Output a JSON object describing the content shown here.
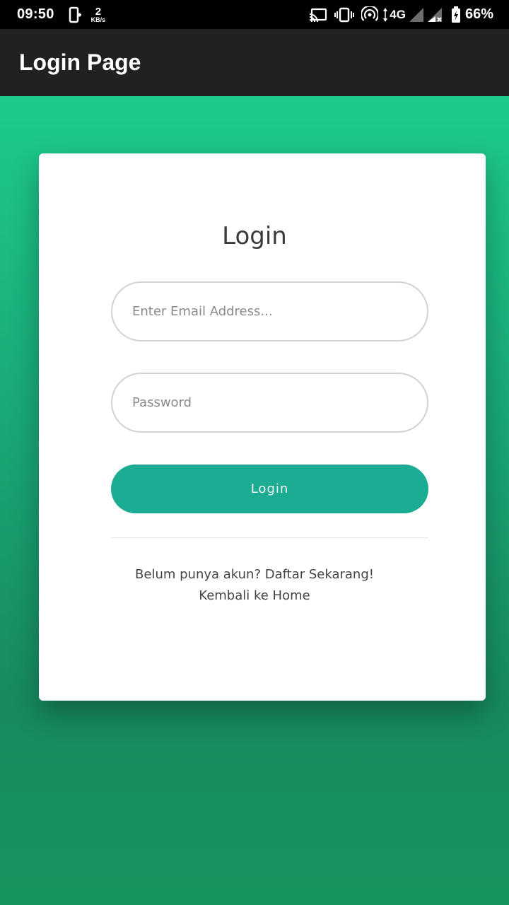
{
  "status_bar": {
    "time": "09:50",
    "speed_value": "2",
    "speed_unit": "KB/s",
    "network": "4G",
    "battery_percent": "66%",
    "icons": [
      "sim-card-icon",
      "cast-icon",
      "vibrate-icon",
      "hotspot-icon",
      "data-arrows-icon",
      "signal-icon",
      "signal-x-icon",
      "battery-charging-icon"
    ]
  },
  "app_bar": {
    "title": "Login Page"
  },
  "login_card": {
    "heading": "Login",
    "email_placeholder": "Enter Email Address...",
    "email_value": "",
    "password_placeholder": "Password",
    "password_value": "",
    "login_button_label": "Login",
    "register_link": "Belum punya akun? Daftar Sekarang!",
    "home_link": "Kembali ke Home"
  },
  "colors": {
    "app_bar": "#212121",
    "background_top": "#1dca8a",
    "background_bottom": "#16965f",
    "button": "#1cac94"
  }
}
